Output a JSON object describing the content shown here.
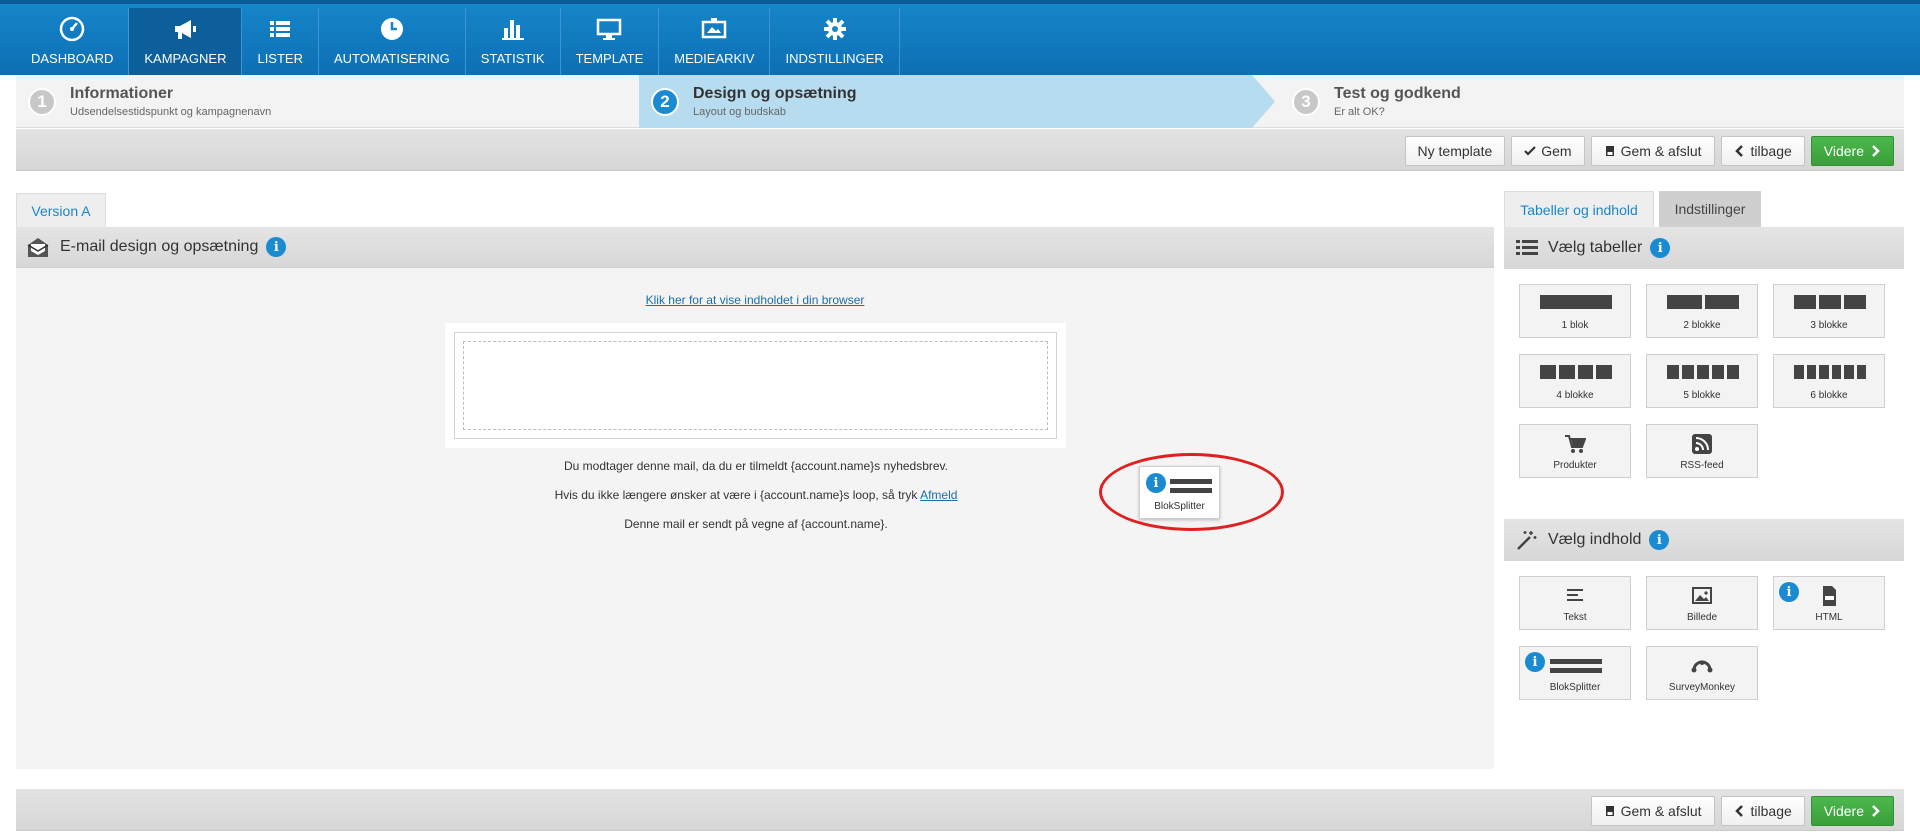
{
  "nav": {
    "items": [
      {
        "label": "DASHBOARD",
        "icon": "dashboard-gauge-icon"
      },
      {
        "label": "KAMPAGNER",
        "icon": "megaphone-icon"
      },
      {
        "label": "LISTER",
        "icon": "list-icon"
      },
      {
        "label": "AUTOMATISERING",
        "icon": "clock-icon"
      },
      {
        "label": "STATISTIK",
        "icon": "bar-chart-icon"
      },
      {
        "label": "TEMPLATE",
        "icon": "monitor-icon"
      },
      {
        "label": "MEDIEARKIV",
        "icon": "media-icon"
      },
      {
        "label": "INDSTILLINGER",
        "icon": "gear-icon"
      }
    ],
    "active": "KAMPAGNER"
  },
  "steps": [
    {
      "num": "1",
      "title": "Informationer",
      "sub": "Udsendelsestidspunkt og kampagnenavn"
    },
    {
      "num": "2",
      "title": "Design og opsætning",
      "sub": "Layout og budskab"
    },
    {
      "num": "3",
      "title": "Test og godkend",
      "sub": "Er alt OK?"
    }
  ],
  "toolbar_top": {
    "new_template": "Ny template",
    "save": "Gem",
    "save_close": "Gem & afslut",
    "back": "tilbage",
    "next": "Videre"
  },
  "toolbar_bottom": {
    "save_close": "Gem & afslut",
    "back": "tilbage",
    "next": "Videre"
  },
  "main": {
    "version_tab": "Version A",
    "panel_title": "E-mail design og opsætning",
    "browser_link": "Klik her for at vise indholdet i din browser",
    "footer_line1": "Du modtager denne mail, da du er tilmeldt {account.name}s nyhedsbrev.",
    "footer_line2": "Hvis du ikke længere ønsker at være i {account.name}s loop, så tryk",
    "unsubscribe": "Afmeld",
    "footer_line3": "Denne mail er sendt på vegne af {account.name}.",
    "dragging_item": "BlokSplitter"
  },
  "sidebar": {
    "tab_content": "Tabeller og indhold",
    "tab_settings": "Indstillinger",
    "tables_title": "Vælg tabeller",
    "tables": [
      "1 blok",
      "2 blokke",
      "3 blokke",
      "4 blokke",
      "5 blokke",
      "6 blokke",
      "Produkter",
      "RSS-feed"
    ],
    "content_title": "Vælg indhold",
    "content": [
      "Tekst",
      "Billede",
      "HTML",
      "BlokSplitter",
      "SurveyMonkey"
    ]
  },
  "info_glyph": "i",
  "colors": {
    "nav_blue": "#1685c9",
    "active_step": "#b7dcf0",
    "green_button": "#3a9f3a",
    "annotation_red": "#e02020"
  }
}
